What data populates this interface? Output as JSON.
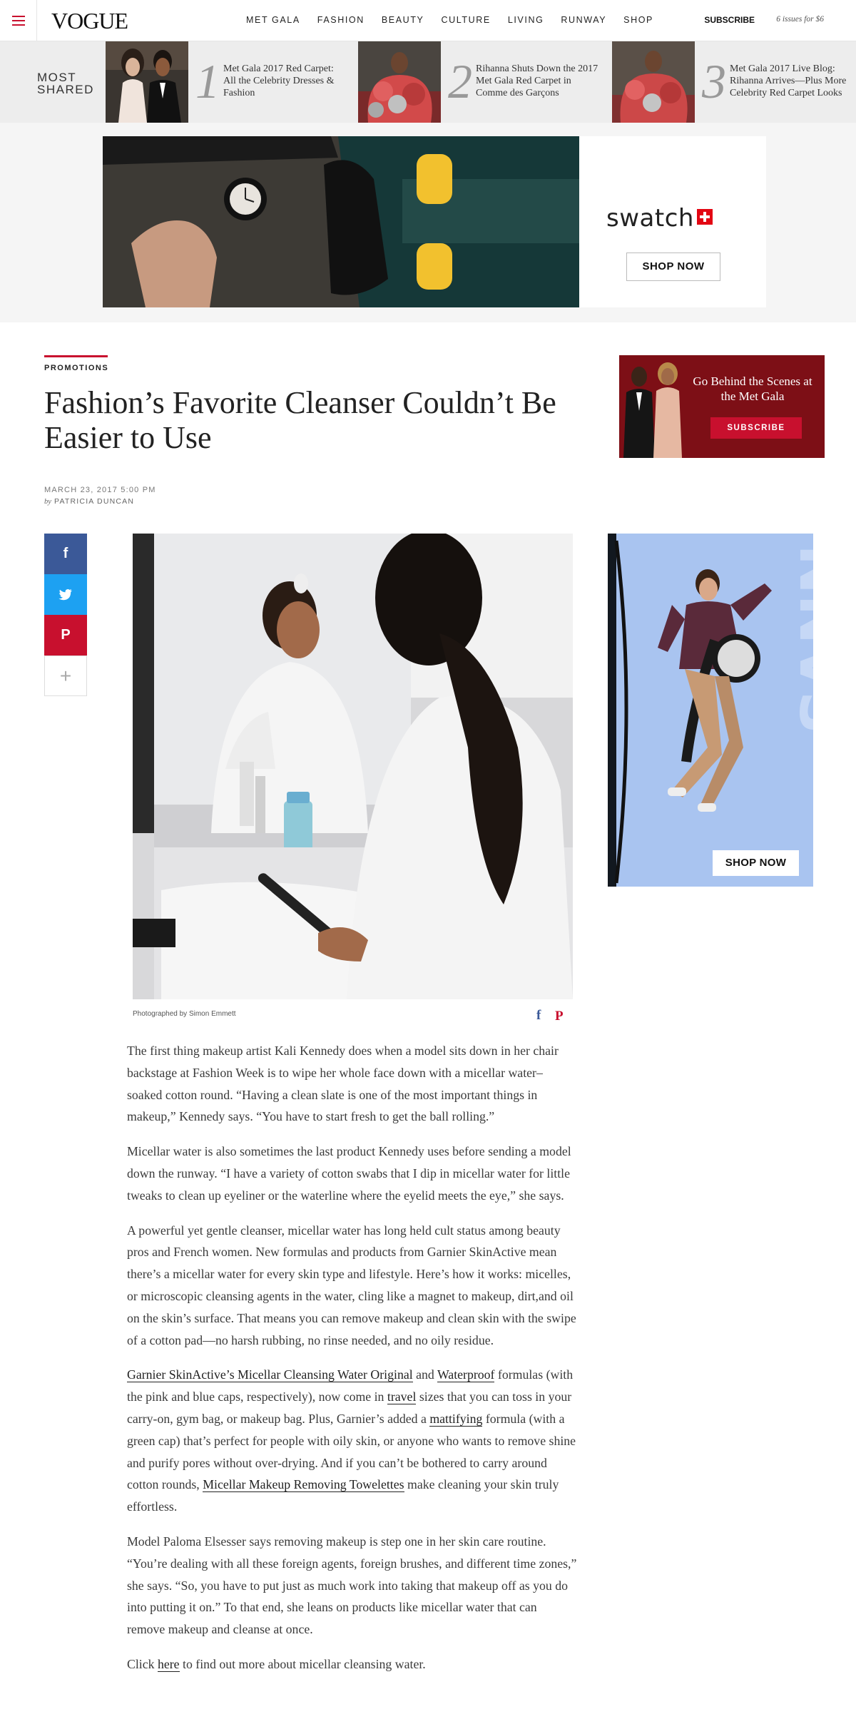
{
  "header": {
    "logo": "VOGUE",
    "nav": [
      "MET GALA",
      "FASHION",
      "BEAUTY",
      "CULTURE",
      "LIVING",
      "RUNWAY",
      "SHOP"
    ],
    "subscribe": "SUBSCRIBE",
    "subscribe_offer": "6 issues for $6"
  },
  "most_shared": {
    "label_line1": "MOST",
    "label_line2": "SHARED",
    "items": [
      {
        "num": "1",
        "title": "Met Gala 2017 Red Carpet: All the Celebrity Dresses & Fashion"
      },
      {
        "num": "2",
        "title": "Rihanna Shuts Down the 2017 Met Gala Red Carpet in Comme des Garçons"
      },
      {
        "num": "3",
        "title": "Met Gala 2017 Live Blog: Rihanna Arrives—Plus More Celebrity Red Carpet Looks"
      }
    ]
  },
  "top_ad": {
    "brand": "swatch",
    "cta": "SHOP NOW"
  },
  "article": {
    "kicker": "PROMOTIONS",
    "headline": "Fashion’s Favorite Cleanser Couldn’t Be Easier to Use",
    "date": "MARCH 23, 2017 5:00 PM",
    "by": "by",
    "author": "PATRICIA DUNCAN",
    "photo_credit": "Photographed by Simon Emmett",
    "paragraphs": {
      "p1": "The first thing makeup artist Kali Kennedy does when a model sits down in her chair backstage at Fashion Week is to wipe her whole face down with a micellar water–soaked cotton round. “Having a clean slate is one of the most important things in makeup,” Kennedy says. “You have to start fresh to get the ball rolling.”",
      "p2": "Micellar water is also sometimes the last product Kennedy uses before sending a model down the runway. “I have a variety of cotton swabs that I dip in micellar water for little tweaks to clean up eyeliner or the waterline where the eyelid meets the eye,” she says.",
      "p3": "A powerful yet gentle cleanser, micellar water has long held cult status among beauty pros and French women. New formulas and products from Garnier SkinActive mean there’s a micellar water for every skin type and lifestyle. Here’s how it works: micelles, or microscopic cleansing agents in the water, cling like a magnet to makeup, dirt,and oil on the skin’s surface. That means you can remove makeup and clean skin with the swipe of a cotton pad—no harsh rubbing, no rinse needed, and no oily residue.",
      "p4_link1": "Garnier SkinActive’s Micellar Cleansing Water Original",
      "p4_t1": " and ",
      "p4_link2": "Waterproof",
      "p4_t2": " formulas (with the pink and blue caps, respectively), now come in ",
      "p4_link3": "travel",
      "p4_t3": " sizes that you can toss in your carry-on, gym bag, or makeup bag. Plus, Garnier’s added a ",
      "p4_link4": "mattifying",
      "p4_t4": " formula (with a green cap) that’s perfect for people with oily skin, or anyone who wants to remove shine and purify pores without over-drying. And if you can’t be bothered to carry around cotton rounds, ",
      "p4_link5": "Micellar Makeup Removing Towelettes",
      "p4_t5": " make cleaning your skin truly effortless.",
      "p5": "Model Paloma Elsesser says removing makeup is step one in her skin care routine. “You’re dealing with all these foreign agents, foreign brushes, and different time zones,” she says. “So, you have to put just as much work into taking that makeup off as you do into putting it on.” To that end, she leans on products like micellar water that can remove makeup and cleanse at once.",
      "p6_t1": "Click ",
      "p6_link": "here",
      "p6_t2": " to find out more about micellar cleansing water."
    }
  },
  "met_promo": {
    "text": "Go Behind the Scenes at the Met Gala",
    "cta": "SUBSCRIBE"
  },
  "side_ad": {
    "cta": "SHOP NOW"
  },
  "social": {
    "facebook_icon": "f",
    "twitter_icon": "twitter-bird",
    "pinterest_icon": "P",
    "more_icon": "+"
  },
  "colors": {
    "accent_red": "#c8102e",
    "facebook": "#3b5998",
    "twitter": "#1da1f2"
  }
}
